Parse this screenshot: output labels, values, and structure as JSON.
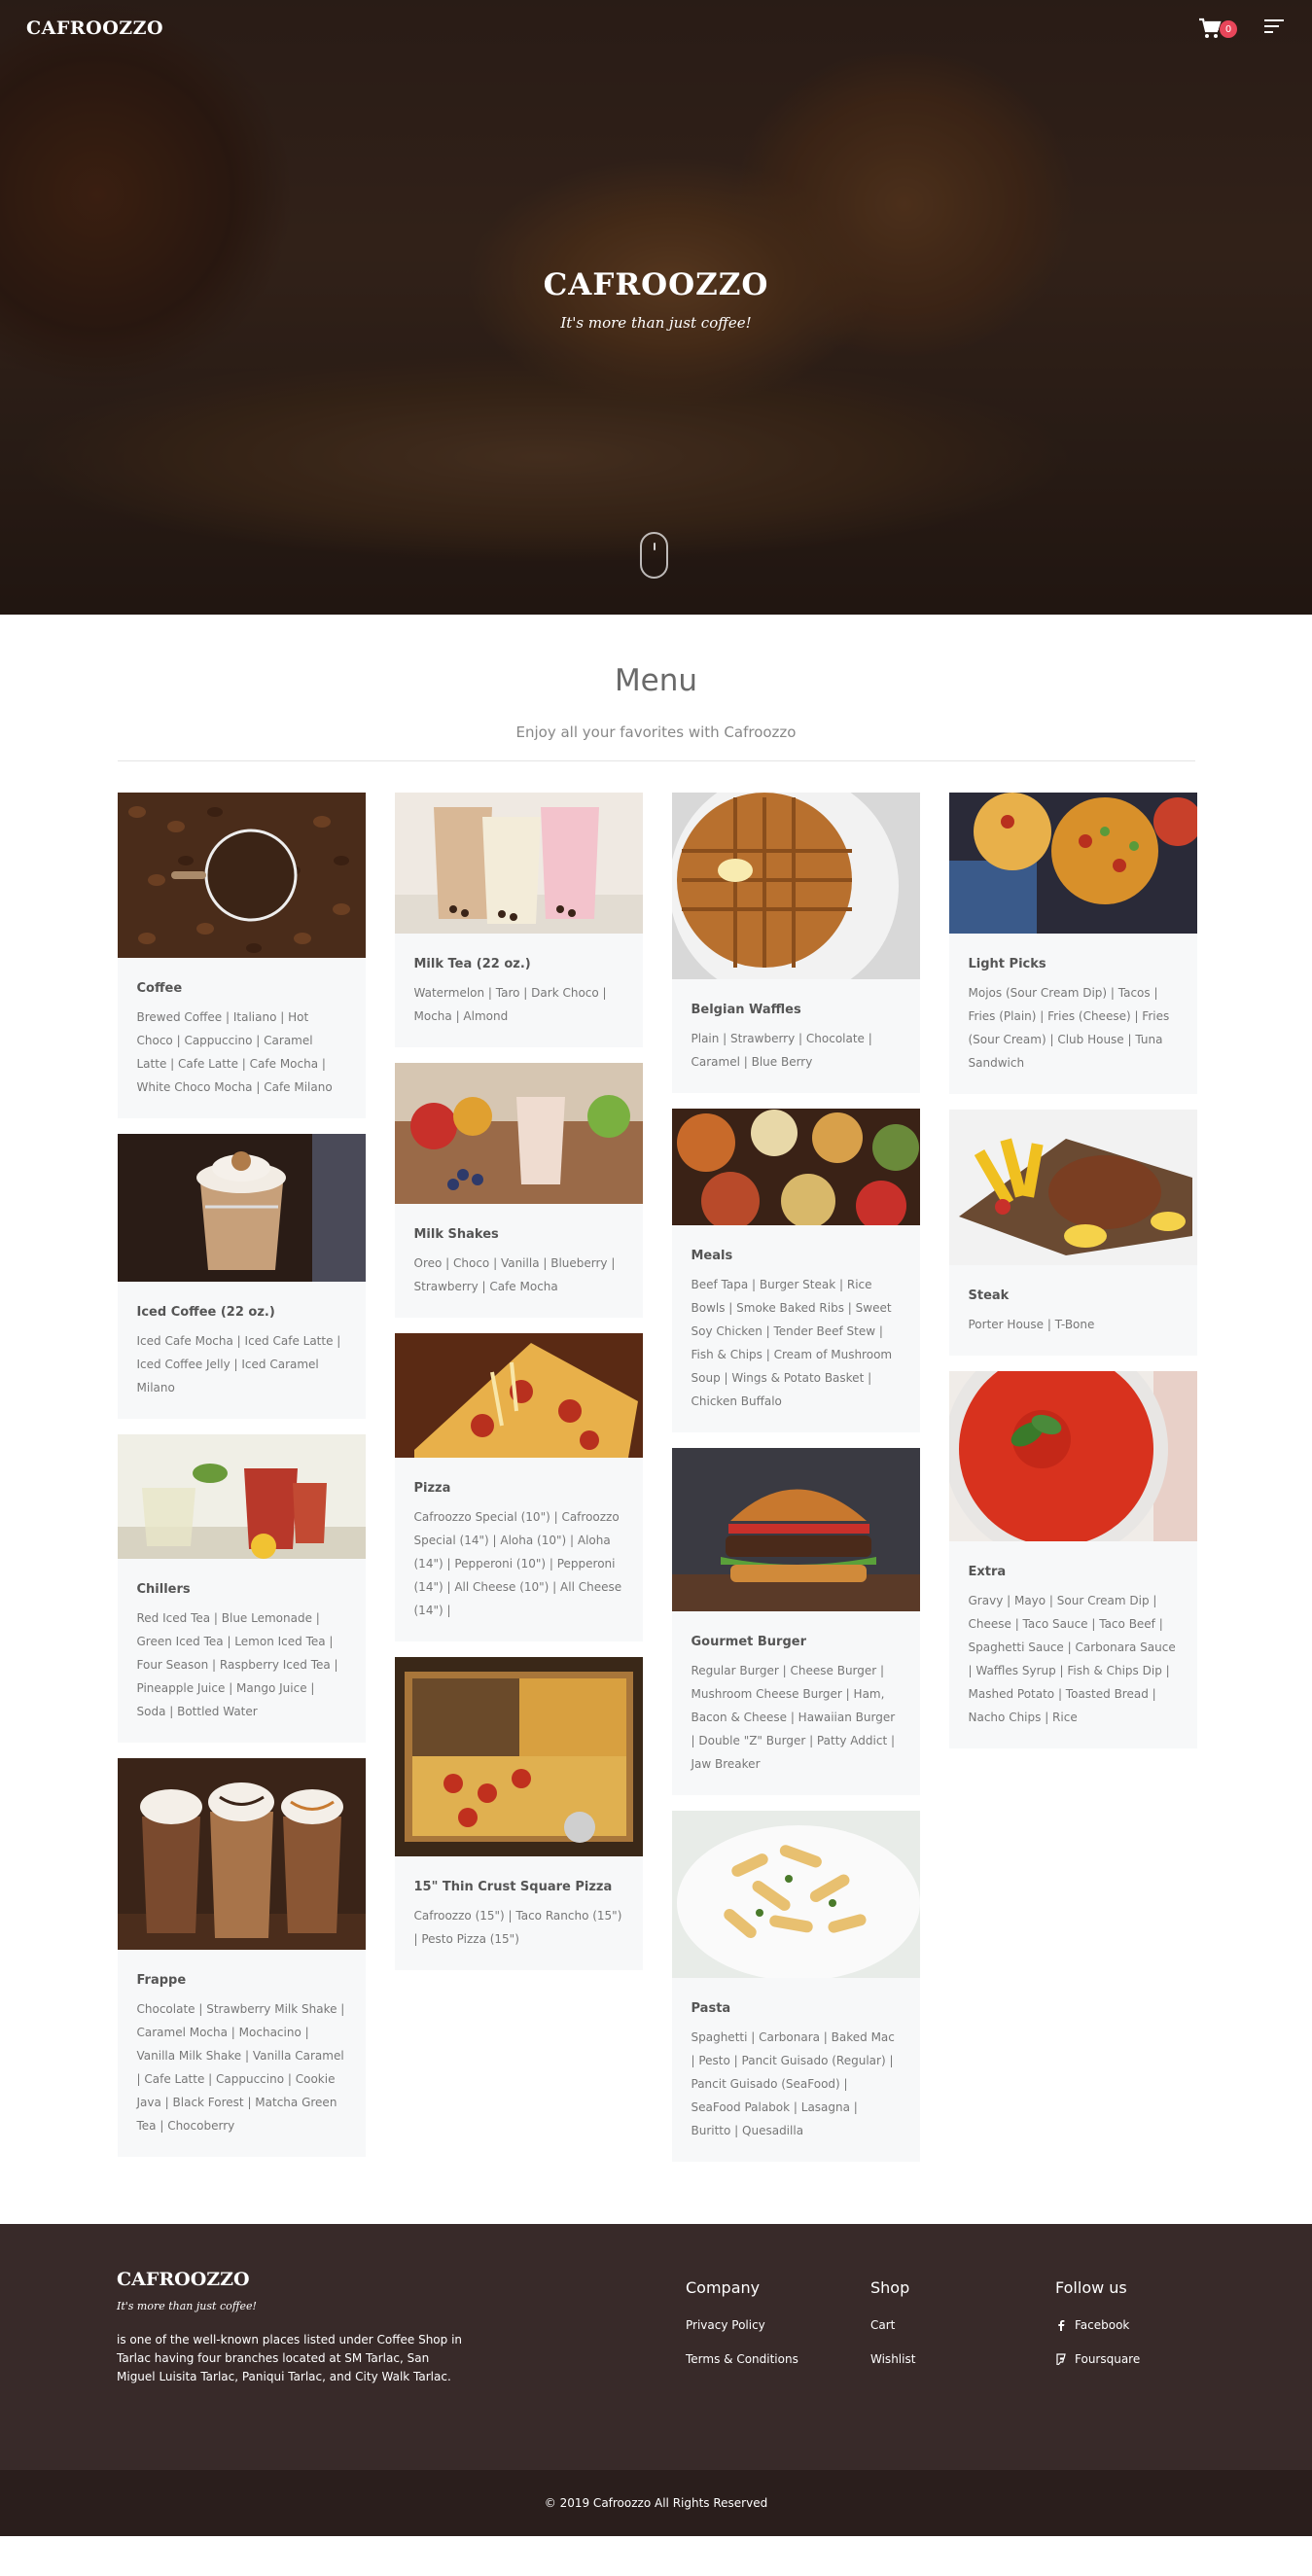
{
  "header": {
    "brand": "CAFROOZZO",
    "cart_count": "0"
  },
  "hero": {
    "title": "CAFROOZZO",
    "tagline": "It's more than just coffee!"
  },
  "menu": {
    "heading": "Menu",
    "subtitle": "Enjoy all your favorites with Cafroozzo",
    "cards": {
      "coffee": {
        "title": "Coffee",
        "items": "Brewed Coffee | Italiano | Hot Choco | Cappuccino | Caramel Latte | Cafe Latte | Cafe Mocha | White Choco Mocha | Cafe Milano"
      },
      "iced_coffee": {
        "title": "Iced Coffee (22 oz.)",
        "items": "Iced Cafe Mocha | Iced Cafe Latte | Iced Coffee Jelly | Iced Caramel Milano"
      },
      "chillers": {
        "title": "Chillers",
        "items": "Red Iced Tea | Blue Lemonade | Green Iced Tea | Lemon Iced Tea | Four Season | Raspberry Iced Tea | Pineapple Juice | Mango Juice | Soda | Bottled Water"
      },
      "frappe": {
        "title": "Frappe",
        "items": "Chocolate | Strawberry Milk Shake | Caramel Mocha | Mochacino | Vanilla Milk Shake | Vanilla Caramel | Cafe Latte | Cappuccino | Cookie Java | Black Forest | Matcha Green Tea | Chocoberry"
      },
      "milk_tea": {
        "title": "Milk Tea (22 oz.)",
        "items": "Watermelon | Taro | Dark Choco | Mocha | Almond"
      },
      "milk_shakes": {
        "title": "Milk Shakes",
        "items": "Oreo | Choco | Vanilla | Blueberry | Strawberry | Cafe Mocha"
      },
      "pizza": {
        "title": "Pizza",
        "items": "Cafroozzo Special (10\") | Cafroozzo Special (14\") | Aloha (10\") | Aloha (14\") | Pepperoni (10\") | Pepperoni (14\") | All Cheese (10\") | All Cheese (14\") |"
      },
      "square_pizza": {
        "title": "15\" Thin Crust Square Pizza",
        "items": "Cafroozzo (15\") | Taco Rancho (15\") | Pesto Pizza (15\")"
      },
      "waffles": {
        "title": "Belgian Waffles",
        "items": "Plain | Strawberry | Chocolate | Caramel | Blue Berry"
      },
      "meals": {
        "title": "Meals",
        "items": "Beef Tapa | Burger Steak | Rice Bowls | Smoke Baked Ribs | Sweet Soy Chicken | Tender Beef Stew | Fish & Chips | Cream of Mushroom Soup | Wings & Potato Basket | Chicken Buffalo"
      },
      "burger": {
        "title": "Gourmet Burger",
        "items": "Regular Burger | Cheese Burger | Mushroom Cheese Burger | Ham, Bacon & Cheese | Hawaiian Burger | Double \"Z\" Burger | Patty Addict | Jaw Breaker"
      },
      "pasta": {
        "title": "Pasta",
        "items": "Spaghetti | Carbonara | Baked Mac | Pesto | Pancit Guisado (Regular) | Pancit Guisado (SeaFood) | SeaFood Palabok | Lasagna | Buritto | Quesadilla"
      },
      "light_picks": {
        "title": "Light Picks",
        "items": "Mojos (Sour Cream Dip) | Tacos | Fries (Plain) | Fries (Cheese) | Fries (Sour Cream) | Club House | Tuna Sandwich"
      },
      "steak": {
        "title": "Steak",
        "items": "Porter House | T-Bone"
      },
      "extra": {
        "title": "Extra",
        "items": "Gravy | Mayo | Sour Cream Dip | Cheese | Taco Sauce | Taco Beef | Spaghetti Sauce | Carbonara Sauce | Waffles Syrup | Fish & Chips Dip | Mashed Potato | Toasted Bread | Nacho Chips | Rice"
      }
    }
  },
  "footer": {
    "brand": "CAFROOZZO",
    "tagline": "It's more than just coffee!",
    "description": "is one of the well-known places listed under Coffee Shop in Tarlac having four branches located at SM Tarlac, San Miguel Luisita Tarlac, Paniqui Tarlac, and City Walk Tarlac.",
    "company": {
      "heading": "Company",
      "links": [
        "Privacy Policy",
        "Terms & Conditions"
      ]
    },
    "shop": {
      "heading": "Shop",
      "links": [
        "Cart",
        "Wishlist"
      ]
    },
    "follow": {
      "heading": "Follow us",
      "links": [
        "Facebook",
        "Foursquare"
      ]
    },
    "copyright": "© 2019 Cafroozzo All Rights Reserved"
  }
}
